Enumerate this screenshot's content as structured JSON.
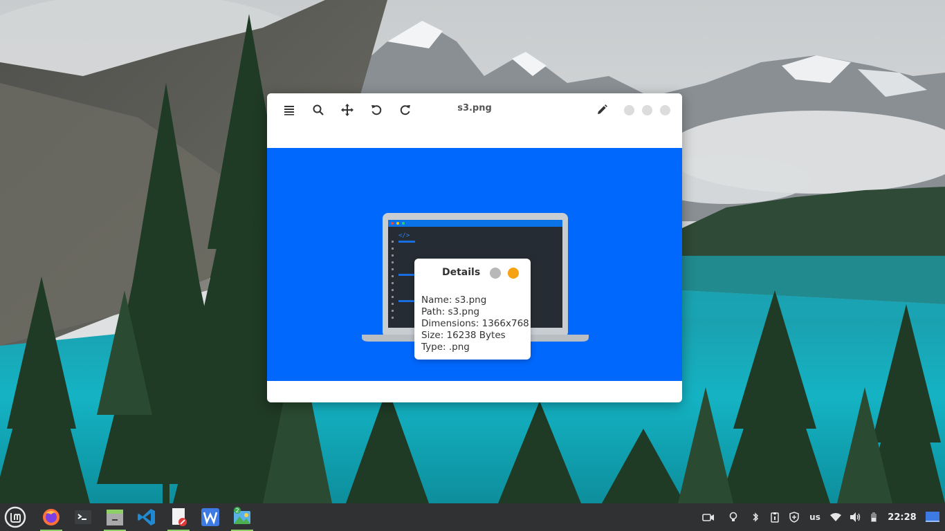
{
  "viewer": {
    "title": "s3.png",
    "toolbar": {
      "menu_icon": "menu-icon",
      "zoom_icon": "search-icon",
      "move_icon": "move-icon",
      "rotate_left_icon": "rotate-left-icon",
      "rotate_right_icon": "rotate-right-icon",
      "edit_icon": "pencil-icon"
    }
  },
  "details": {
    "title": "Details",
    "name": "Name: s3.png",
    "path": "Path: s3.png",
    "dimensions": "Dimensions: 1366x768",
    "size": "Size: 16238 Bytes",
    "type": "Type: .png"
  },
  "taskbar": {
    "apps": [
      "mint-menu",
      "firefox",
      "terminal",
      "file-manager",
      "vscode",
      "text-editor",
      "wps-writer",
      "image-viewer"
    ],
    "image_viewer_badge": "2",
    "keyboard_layout": "us",
    "clock": "22:28"
  },
  "colors": {
    "image_background": "#0068fd",
    "taskbar": "#2f3133",
    "accent_orange": "#f5a312"
  }
}
